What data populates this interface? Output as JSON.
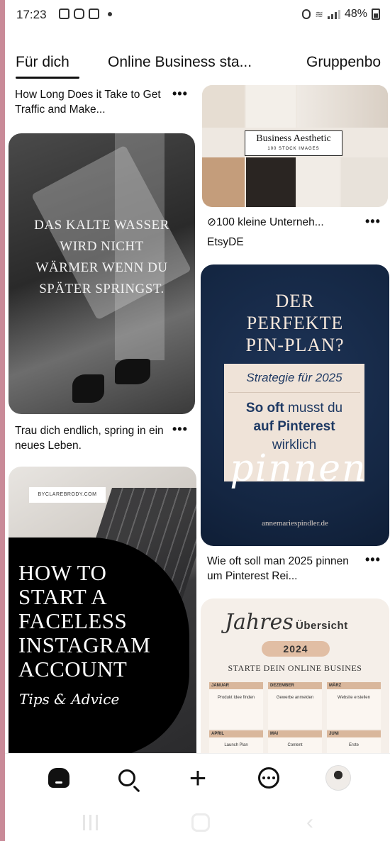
{
  "status_bar": {
    "time": "17:23",
    "battery": "48%"
  },
  "tabs": [
    {
      "label": "Für dich"
    },
    {
      "label": "Online Business sta..."
    },
    {
      "label": "Gruppenbo"
    }
  ],
  "feed": {
    "pin_top_left": {
      "caption": "How Long Does it Take to Get Traffic and Make...",
      "more": "•••"
    },
    "pin_quote": {
      "overlay_text": "DAS KALTE WASSER WIRD NICHT WÄRMER WENN DU SPÄTER SPRINGST.",
      "caption": "Trau dich endlich, spring in ein neues Leben.",
      "more": "•••"
    },
    "pin_aesthetic": {
      "overlay_title": "Business Aesthetic",
      "overlay_sub": "100 STOCK IMAGES",
      "caption": "100 kleine Unterneh...",
      "source": "EtsyDE",
      "more": "•••"
    },
    "pin_plan": {
      "title": "DER PERFEKTE PIN-PLAN?",
      "strategy": "Strategie für 2025",
      "so_oft": "So oft",
      "musst": "musst du",
      "auf": "auf Pinterest",
      "wirklich": "wirklich",
      "pinnen": "pinnen",
      "url": "annemariespindler.de",
      "caption": "Wie oft soll man 2025 pinnen um Pinterest Rei...",
      "more": "•••"
    },
    "pin_faceless": {
      "tag": "BYCLAREBRODY.COM",
      "title_lines": [
        "HOW TO",
        "START A",
        "FACELESS",
        "INSTAGRAM",
        "ACCOUNT"
      ],
      "tips": "Tips & Advice"
    },
    "pin_jahres": {
      "script": "Jahres",
      "uebersicht": "Übersicht",
      "year": "2024",
      "start": "STARTE DEIN ONLINE BUSINES",
      "months": [
        {
          "name": "JANUAR",
          "text": "Produkt Idee finden"
        },
        {
          "name": "DEZEMBER",
          "text": "Gewerbe anmelden"
        },
        {
          "name": "MÄRZ",
          "text": "Website erstellen"
        }
      ],
      "months2": [
        {
          "name": "APRIL",
          "text": "Launch Plan"
        },
        {
          "name": "MAI",
          "text": "Content"
        },
        {
          "name": "JUNI",
          "text": "Erste"
        }
      ]
    }
  },
  "bottom_nav": [
    "Home",
    "Suche",
    "Erstellen",
    "Nachrichten",
    "Profil"
  ]
}
